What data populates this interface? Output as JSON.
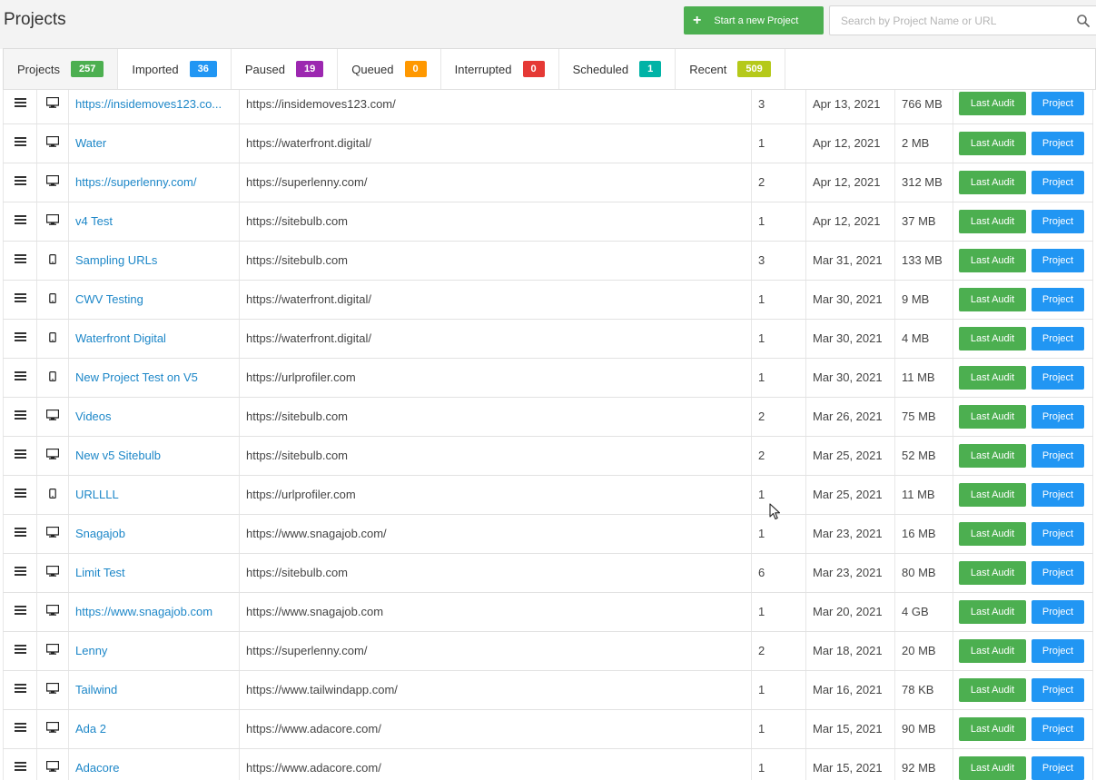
{
  "header": {
    "title": "Projects",
    "new_project_label": "Start a new Project",
    "search_placeholder": "Search by Project Name or URL"
  },
  "tabs": [
    {
      "label": "Projects",
      "count": "257",
      "color": "#4caf50",
      "active": true
    },
    {
      "label": "Imported",
      "count": "36",
      "color": "#2196f3"
    },
    {
      "label": "Paused",
      "count": "19",
      "color": "#9c27b0"
    },
    {
      "label": "Queued",
      "count": "0",
      "color": "#ff9800"
    },
    {
      "label": "Interrupted",
      "count": "0",
      "color": "#e53935"
    },
    {
      "label": "Scheduled",
      "count": "1",
      "color": "#00b3a6"
    },
    {
      "label": "Recent",
      "count": "509",
      "color": "#b5c91a"
    }
  ],
  "row_actions": {
    "last_audit": "Last Audit",
    "project": "Project"
  },
  "rows": [
    {
      "device": "desktop",
      "name": "https://insidemoves123.co...",
      "url": "https://insidemoves123.com/",
      "audits": "3",
      "date": "Apr 13, 2021",
      "size": "766 MB"
    },
    {
      "device": "desktop",
      "name": "Water",
      "url": "https://waterfront.digital/",
      "audits": "1",
      "date": "Apr 12, 2021",
      "size": "2 MB"
    },
    {
      "device": "desktop",
      "name": "https://superlenny.com/",
      "url": "https://superlenny.com/",
      "audits": "2",
      "date": "Apr 12, 2021",
      "size": "312 MB"
    },
    {
      "device": "desktop",
      "name": "v4 Test",
      "url": "https://sitebulb.com",
      "audits": "1",
      "date": "Apr 12, 2021",
      "size": "37 MB"
    },
    {
      "device": "mobile",
      "name": "Sampling URLs",
      "url": "https://sitebulb.com",
      "audits": "3",
      "date": "Mar 31, 2021",
      "size": "133 MB"
    },
    {
      "device": "mobile",
      "name": "CWV Testing",
      "url": "https://waterfront.digital/",
      "audits": "1",
      "date": "Mar 30, 2021",
      "size": "9 MB"
    },
    {
      "device": "mobile",
      "name": "Waterfront Digital",
      "url": "https://waterfront.digital/",
      "audits": "1",
      "date": "Mar 30, 2021",
      "size": "4 MB"
    },
    {
      "device": "mobile",
      "name": "New Project Test on V5",
      "url": "https://urlprofiler.com",
      "audits": "1",
      "date": "Mar 30, 2021",
      "size": "11 MB"
    },
    {
      "device": "desktop",
      "name": "Videos",
      "url": "https://sitebulb.com",
      "audits": "2",
      "date": "Mar 26, 2021",
      "size": "75 MB"
    },
    {
      "device": "desktop",
      "name": "New v5 Sitebulb",
      "url": "https://sitebulb.com",
      "audits": "2",
      "date": "Mar 25, 2021",
      "size": "52 MB"
    },
    {
      "device": "mobile",
      "name": "URLLLL",
      "url": "https://urlprofiler.com",
      "audits": "1",
      "date": "Mar 25, 2021",
      "size": "11 MB"
    },
    {
      "device": "desktop",
      "name": "Snagajob",
      "url": "https://www.snagajob.com/",
      "audits": "1",
      "date": "Mar 23, 2021",
      "size": "16 MB"
    },
    {
      "device": "desktop",
      "name": "Limit Test",
      "url": "https://sitebulb.com",
      "audits": "6",
      "date": "Mar 23, 2021",
      "size": "80 MB"
    },
    {
      "device": "desktop",
      "name": "https://www.snagajob.com",
      "url": "https://www.snagajob.com",
      "audits": "1",
      "date": "Mar 20, 2021",
      "size": "4 GB"
    },
    {
      "device": "desktop",
      "name": "Lenny",
      "url": "https://superlenny.com/",
      "audits": "2",
      "date": "Mar 18, 2021",
      "size": "20 MB"
    },
    {
      "device": "desktop",
      "name": "Tailwind",
      "url": "https://www.tailwindapp.com/",
      "audits": "1",
      "date": "Mar 16, 2021",
      "size": "78 KB"
    },
    {
      "device": "desktop",
      "name": "Ada 2",
      "url": "https://www.adacore.com/",
      "audits": "1",
      "date": "Mar 15, 2021",
      "size": "90 MB"
    },
    {
      "device": "desktop",
      "name": "Adacore",
      "url": "https://www.adacore.com/",
      "audits": "1",
      "date": "Mar 15, 2021",
      "size": "92 MB"
    }
  ]
}
